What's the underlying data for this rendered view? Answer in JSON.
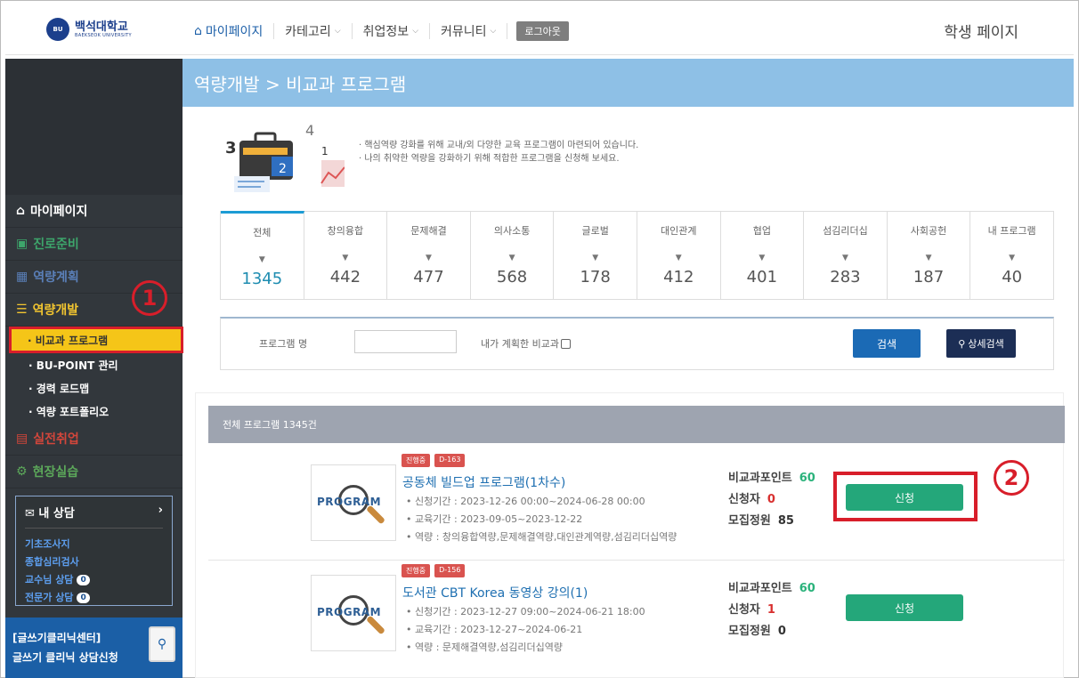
{
  "header": {
    "logo_text": "백석대학교",
    "logo_sub": "BAEKSEOK UNIVERSITY",
    "nav": [
      {
        "label": "마이페이지",
        "icon": "home-icon"
      },
      {
        "label": "카테고리",
        "icon": "chevron-down-icon"
      },
      {
        "label": "취업정보",
        "icon": "chevron-down-icon"
      },
      {
        "label": "커뮤니티",
        "icon": "chevron-down-icon"
      }
    ],
    "logout": "로그아웃",
    "student_page": "학생 페이지"
  },
  "sidebar": {
    "items": [
      {
        "label": "마이페이지",
        "color": "#ffffff"
      },
      {
        "label": "진로준비",
        "color": "#3da56b"
      },
      {
        "label": "역량계획",
        "color": "#5a7fb8"
      },
      {
        "label": "역량개발",
        "color": "#f2c530"
      }
    ],
    "sub_items": [
      {
        "label": "· 비교과 프로그램",
        "active": true
      },
      {
        "label": "· BU-POINT 관리"
      },
      {
        "label": "· 경력 로드맵"
      },
      {
        "label": "· 역량 포트폴리오"
      }
    ],
    "items2": [
      {
        "label": "실전취업",
        "color": "#d2463b"
      },
      {
        "label": "현장실습",
        "color": "#5ca85a"
      }
    ],
    "consult": {
      "title": "내 상담",
      "links": [
        {
          "label": "기초조사지"
        },
        {
          "label": "종합심리검사"
        },
        {
          "label": "교수님 상담",
          "count": "0"
        },
        {
          "label": "전문가 상담",
          "count": "0"
        }
      ]
    },
    "clinic": {
      "line1": "[글쓰기클리닉센터]",
      "line2": "글쓰기 클리닉 상담신청"
    }
  },
  "main": {
    "breadcrumb": "역량개발 > 비교과 프로그램",
    "intro_lines": [
      "· 핵심역량 강화를 위해 교내/외 다양한 교육 프로그램이 마련되어 있습니다.",
      "· 나의 취약한 역량을 강화하기 위해 적합한 프로그램을 신청해 보세요."
    ],
    "tabs": [
      {
        "label": "전체",
        "count": "1345"
      },
      {
        "label": "창의융합",
        "count": "442"
      },
      {
        "label": "문제해결",
        "count": "477"
      },
      {
        "label": "의사소통",
        "count": "568"
      },
      {
        "label": "글로벌",
        "count": "178"
      },
      {
        "label": "대인관계",
        "count": "412"
      },
      {
        "label": "협업",
        "count": "401"
      },
      {
        "label": "섬김리더십",
        "count": "283"
      },
      {
        "label": "사회공헌",
        "count": "187"
      },
      {
        "label": "내 프로그램",
        "count": "40"
      }
    ],
    "search": {
      "program_label": "프로그램 명",
      "program_value": "",
      "check_label": "내가 계획한 비교과",
      "search_btn": "검색",
      "detail_btn": "상세검색"
    },
    "list_header": "전체 프로그램 1345건",
    "programs": [
      {
        "badge_status": "진행중",
        "badge_day": "D-163",
        "thumb": "PROGRAM",
        "title": "공동체 빌드업 프로그램(1차수)",
        "apply_period": "• 신청기간 : 2023-12-26 00:00~2024-06-28 00:00",
        "edu_period": "• 교육기간 : 2023-09-05~2023-12-22",
        "competency": "• 역량 : 창의융합역량,문제해결역량,대인관계역량,섬김리더십역량",
        "point_label": "비교과포인트",
        "point": "60",
        "applicant_label": "신청자",
        "applicants": "0",
        "quota_label": "모집정원",
        "quota": "85",
        "apply_btn": "신청"
      },
      {
        "badge_status": "진행중",
        "badge_day": "D-156",
        "thumb": "PROGRAM",
        "title": "도서관 CBT Korea 동영상 강의(1)",
        "apply_period": "• 신청기간 : 2023-12-27 09:00~2024-06-21 18:00",
        "edu_period": "• 교육기간 : 2023-12-27~2024-06-21",
        "competency": "• 역량 : 문제해결역량,섬김리더십역량",
        "point_label": "비교과포인트",
        "point": "60",
        "applicant_label": "신청자",
        "applicants": "1",
        "quota_label": "모집정원",
        "quota": "0",
        "apply_btn": "신청"
      }
    ]
  },
  "annotations": [
    "1",
    "2"
  ]
}
